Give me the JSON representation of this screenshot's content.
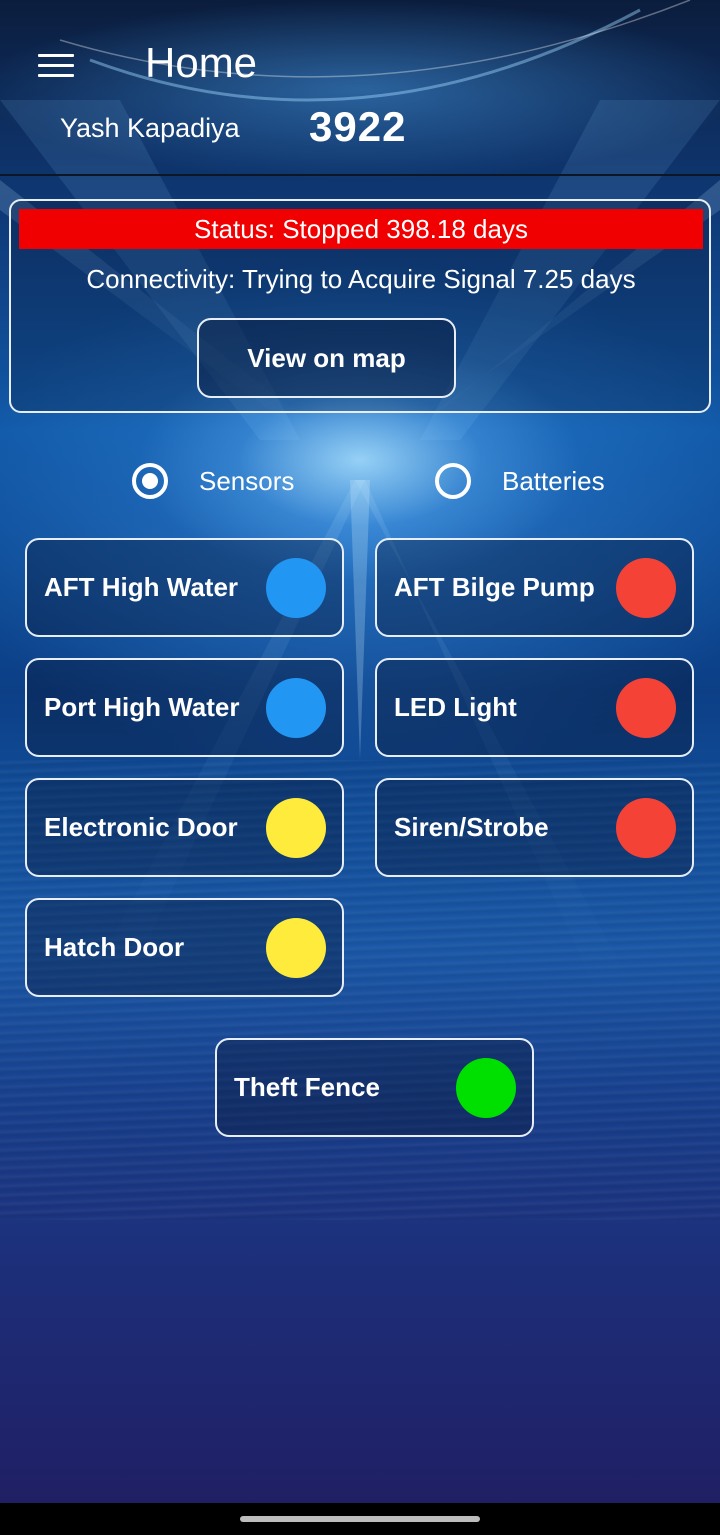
{
  "header": {
    "title": "Home",
    "user_name": "Yash Kapadiya",
    "device_id": "3922",
    "menu_icon": "hamburger-menu-icon"
  },
  "status": {
    "status_text": "Status: Stopped 398.18 days",
    "status_color": "#f00000",
    "connectivity_text": "Connectivity: Trying to Acquire Signal 7.25 days",
    "map_button_label": "View on map"
  },
  "view_toggle": {
    "options": [
      {
        "label": "Sensors",
        "selected": true
      },
      {
        "label": "Batteries",
        "selected": false
      }
    ]
  },
  "sensors": [
    {
      "label": "AFT High Water",
      "color": "#2196f3"
    },
    {
      "label": "AFT Bilge Pump",
      "color": "#f44336"
    },
    {
      "label": "Port High Water",
      "color": "#2196f3"
    },
    {
      "label": "LED Light",
      "color": "#f44336"
    },
    {
      "label": "Electronic Door",
      "color": "#ffeb3b"
    },
    {
      "label": "Siren/Strobe",
      "color": "#f44336"
    },
    {
      "label": "Hatch Door",
      "color": "#ffeb3b"
    },
    {
      "label": "Theft Fence",
      "color": "#00e000"
    }
  ]
}
